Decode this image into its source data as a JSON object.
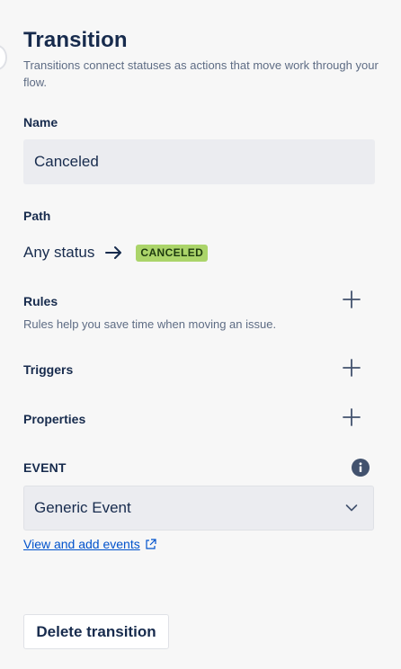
{
  "header": {
    "title": "Transition",
    "subtitle": "Transitions connect statuses as actions that move work through your flow."
  },
  "name_field": {
    "label": "Name",
    "value": "Canceled"
  },
  "path": {
    "label": "Path",
    "from": "Any status",
    "to": "CANCELED",
    "to_color": "#abd46a"
  },
  "rules": {
    "label": "Rules",
    "helper": "Rules help you save time when moving an issue.",
    "add_icon": "plus-icon"
  },
  "triggers": {
    "label": "Triggers",
    "add_icon": "plus-icon"
  },
  "properties": {
    "label": "Properties",
    "add_icon": "plus-icon"
  },
  "event": {
    "label": "EVENT",
    "info_icon": "info-icon",
    "selected": "Generic Event",
    "link": "View and add events",
    "link_icon": "external-link-icon"
  },
  "actions": {
    "delete_label": "Delete transition"
  },
  "colors": {
    "link": "#0052cc",
    "field_bg": "#ebecf0",
    "text": "#172b4d",
    "muted": "#5e6c84"
  }
}
